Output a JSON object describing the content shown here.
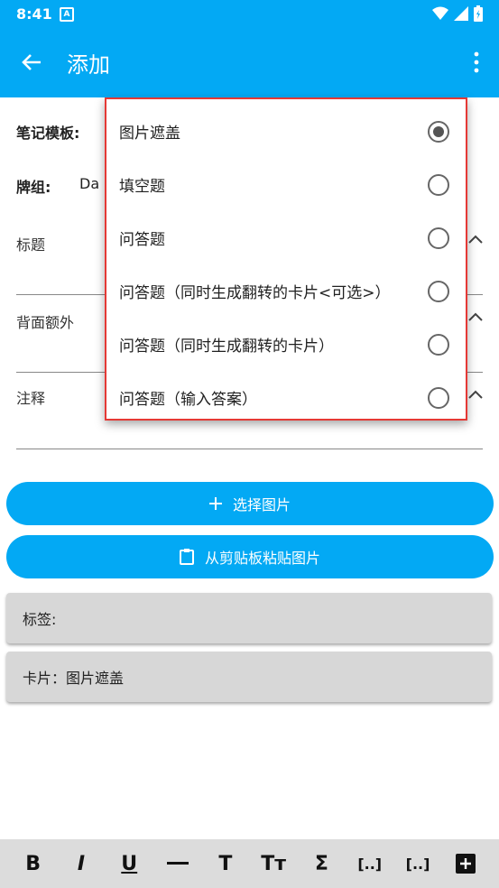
{
  "status": {
    "time": "8:41",
    "notif": "A"
  },
  "appbar": {
    "title": "添加"
  },
  "form": {
    "note_type_label": "笔记模板:",
    "deck_label": "牌组:",
    "deck_value": "Da",
    "fields": [
      "标题",
      "背面额外",
      "注释"
    ]
  },
  "popup": {
    "options": [
      {
        "label": "图片遮盖",
        "selected": true
      },
      {
        "label": "填空题",
        "selected": false
      },
      {
        "label": "问答题",
        "selected": false
      },
      {
        "label": "问答题（同时生成翻转的卡片<可选>）",
        "selected": false
      },
      {
        "label": "问答题（同时生成翻转的卡片）",
        "selected": false
      },
      {
        "label": "问答题（输入答案）",
        "selected": false
      }
    ]
  },
  "buttons": {
    "select_image": "选择图片",
    "paste_image": "从剪贴板粘贴图片"
  },
  "cards": {
    "tags": "标签:",
    "cards": "卡片：图片遮盖"
  },
  "toolbar": {
    "items": [
      "bold",
      "italic",
      "underline",
      "horizontal-rule",
      "title",
      "text-size",
      "mathjax",
      "cloze-new",
      "cloze",
      "add-custom"
    ]
  },
  "colors": {
    "accent": "#03a9f4",
    "highlight": "#e53935"
  }
}
